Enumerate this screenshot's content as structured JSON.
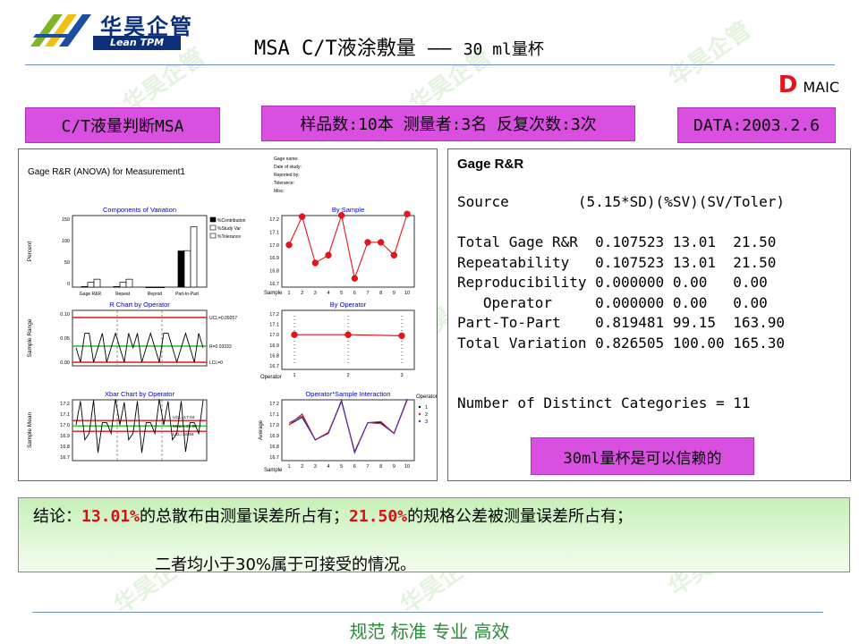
{
  "logo": {
    "cn": "华昊企管",
    "en": "Lean TPM"
  },
  "title": {
    "main": "MSA C/T液涂敷量 —— ",
    "sub": "30 ml量杯"
  },
  "dmaic": {
    "letter": "D",
    "rest": "MAIC"
  },
  "watermark": "华昊企管",
  "boxes": {
    "left": "C/T液量判断MSA",
    "middle": "样品数:10本  测量者:3名  反复次数:3次",
    "right": "DATA:2003.2.6"
  },
  "minitab": {
    "title": "Gage R&R (ANOVA) for Measurement1",
    "info_lines": [
      "Gage name:",
      "Date of study:",
      "Reported by:",
      "Tolerance:",
      "Misc:"
    ],
    "c1": {
      "title": "Components of Variation",
      "ylabel": "Percent",
      "yticks": [
        "150",
        "100",
        "50",
        "0"
      ],
      "categories": [
        "Gage R&R",
        "Repeat",
        "Reprod",
        "Part-to-Part"
      ],
      "legend": [
        "%Contribution",
        "%Study Var",
        "%Tolerance"
      ],
      "values": [
        [
          1.7,
          13.01,
          21.5
        ],
        [
          1.7,
          13.01,
          21.5
        ],
        [
          0,
          0,
          0
        ],
        [
          98.3,
          99.15,
          163.9
        ]
      ]
    },
    "c2": {
      "title": "By Sample",
      "xlabel": "Sample",
      "yticks": [
        "17.2",
        "17.1",
        "17.0",
        "16.9",
        "16.8",
        "16.7"
      ],
      "xticks": [
        "1",
        "2",
        "3",
        "4",
        "5",
        "6",
        "7",
        "8",
        "9",
        "10"
      ],
      "values": [
        17.0,
        17.22,
        16.86,
        16.92,
        17.23,
        16.74,
        17.02,
        17.02,
        16.92,
        17.24
      ]
    },
    "c3": {
      "title": "R Chart by Operator",
      "ylabel": "Sample Range",
      "yticks": [
        "0.10",
        "0.05",
        "0.00"
      ],
      "ucl": "UCL=0.09257",
      "rbar": "R=0.03333",
      "lcl": "LCL=0",
      "values": [
        0.03,
        0.0,
        0.06,
        0.06,
        0.0,
        0.03,
        0.06,
        0.0,
        0.03,
        0.06,
        0.03,
        0.0,
        0.06,
        0.03,
        0.06,
        0.0,
        0.03,
        0.06,
        0.03,
        0.0,
        0.06,
        0.06,
        0.03,
        0.0,
        0.03,
        0.06,
        0.03,
        0.0,
        0.06,
        0.03
      ]
    },
    "c4": {
      "title": "By Operator",
      "xlabel": "Operator",
      "yticks": [
        "17.2",
        "17.1",
        "17.0",
        "16.9",
        "16.8",
        "16.7"
      ],
      "xticks": [
        "1",
        "2",
        "3"
      ],
      "values": [
        17.0,
        17.0,
        16.99
      ]
    },
    "c5": {
      "title": "Xbar Chart by Operator",
      "ylabel": "Sample Mean",
      "yticks": [
        "17.2",
        "17.1",
        "17.0",
        "16.9",
        "16.8",
        "16.7"
      ],
      "ucl": "UCL=17.04",
      "mean": "Mean=16.99",
      "lcl": "LCL=16.94",
      "values": [
        17.0,
        17.22,
        16.86,
        16.92,
        17.23,
        16.74,
        17.02,
        17.02,
        16.92,
        17.24,
        17.0,
        17.21,
        16.86,
        16.92,
        17.22,
        16.74,
        17.02,
        17.02,
        16.92,
        17.24,
        17.0,
        17.22,
        16.86,
        16.92,
        17.22,
        16.75,
        17.02,
        17.02,
        16.92,
        17.23
      ]
    },
    "c6": {
      "title": "Operator*Sample Interaction",
      "xlabel": "Sample",
      "ylabel": "Average",
      "yticks": [
        "17.2",
        "17.1",
        "17.0",
        "16.9",
        "16.8",
        "16.7"
      ],
      "xticks": [
        "1",
        "2",
        "3",
        "4",
        "5",
        "6",
        "7",
        "8",
        "9",
        "10"
      ],
      "legend_title": "Operator",
      "legend": [
        "1",
        "2",
        "3"
      ],
      "series": [
        [
          17.0,
          17.07,
          16.86,
          16.92,
          17.23,
          16.74,
          17.02,
          17.02,
          16.92,
          17.24
        ],
        [
          17.0,
          17.1,
          16.86,
          16.93,
          17.22,
          16.75,
          17.02,
          17.03,
          16.92,
          17.23
        ],
        [
          17.02,
          17.08,
          16.86,
          16.92,
          17.22,
          16.74,
          17.02,
          17.01,
          16.92,
          17.24
        ]
      ]
    }
  },
  "gage": {
    "title": "Gage R&R",
    "header": "Source        (5.15*SD)(%SV)(SV/Toler)",
    "rows": [
      "Total Gage R&R  0.107523 13.01  21.50",
      "Repeatability   0.107523 13.01  21.50",
      "Reproducibility 0.000000 0.00   0.00",
      "   Operator     0.000000 0.00   0.00",
      "Part-To-Part    0.819481 99.15  163.90",
      "Total Variation 0.826505 100.00 165.30"
    ],
    "ndc": "Number of Distinct Categories = 11",
    "verdict": "30ml量杯是可以信赖的"
  },
  "conclusion": {
    "l1_prefix": "结论：",
    "l1_v1": "13.01%",
    "l1_mid": "的总散布由测量误差所占有；",
    "l1_v2": "21.50%",
    "l1_end": "的规格公差被测量误差所占有；",
    "l2": "二者均小于30%属于可接受的情况。"
  },
  "footer": "规范 标准 专业 高效",
  "colors": {
    "magenta": "#d94fe0",
    "accent_red": "#d8101a",
    "footer_green": "#2a8a3a"
  }
}
